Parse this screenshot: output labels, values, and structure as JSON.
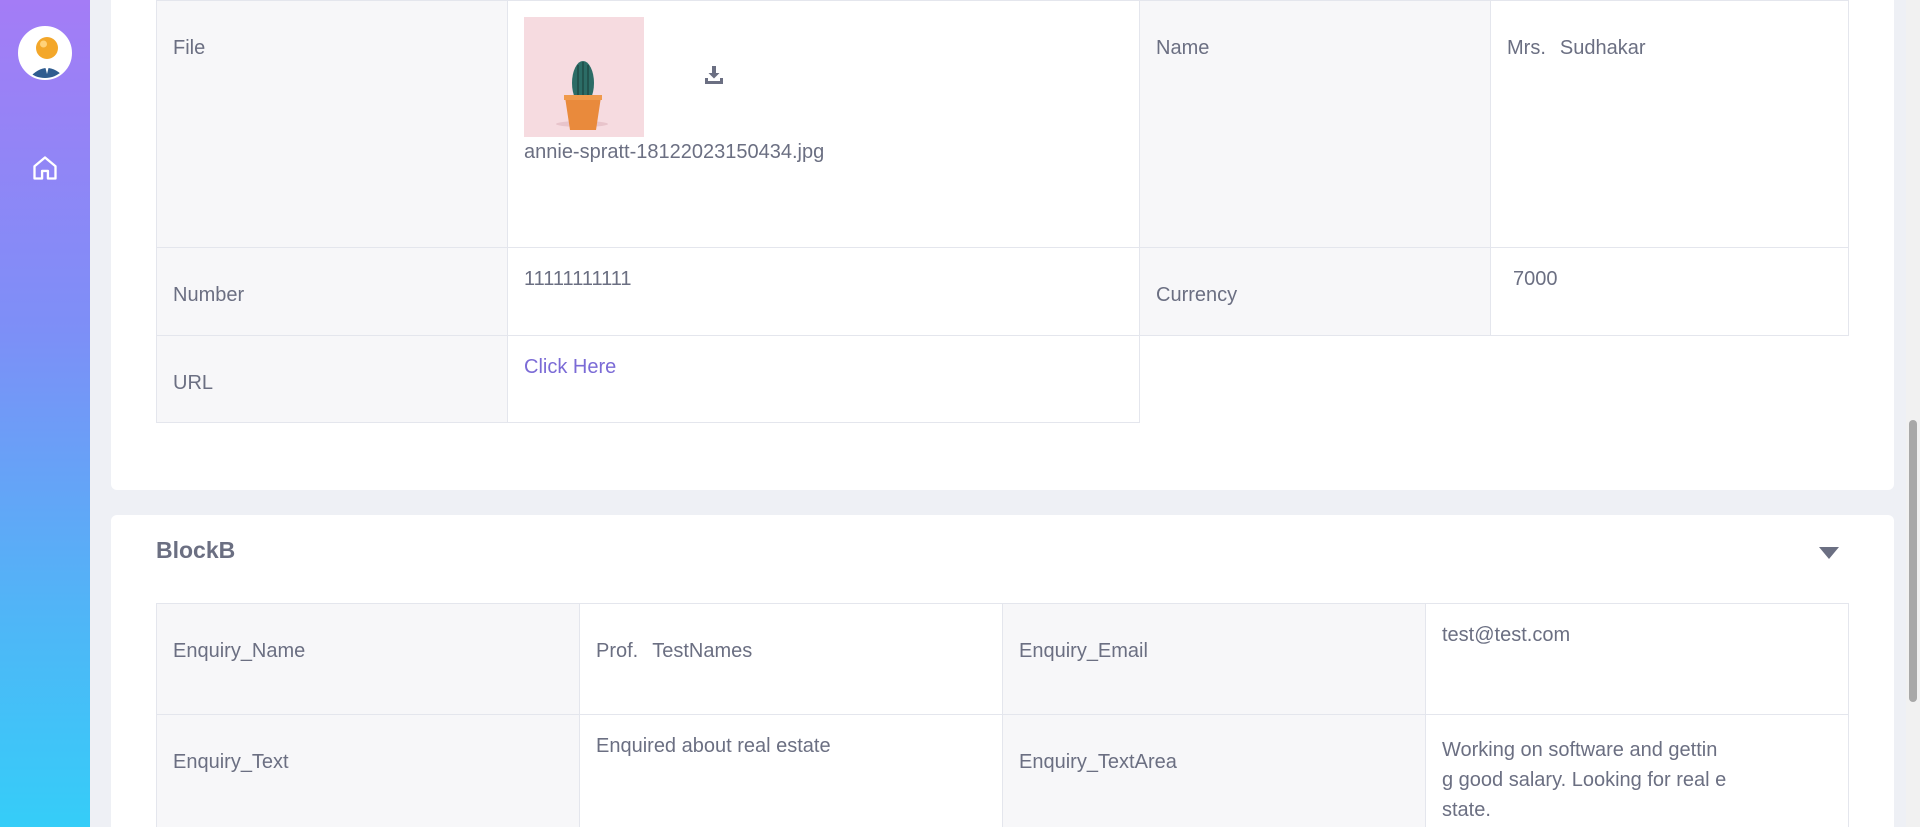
{
  "sidebar": {
    "avatar_icon": "user-avatar-icon",
    "nav": [
      {
        "icon": "home-icon"
      }
    ]
  },
  "block_a": {
    "rows": {
      "file": {
        "label": "File",
        "file_name": "annie-spratt-18122023150434.jpg",
        "download_icon": "download-icon"
      },
      "name": {
        "label": "Name",
        "prefix": "Mrs.",
        "value": "Sudhakar"
      },
      "number": {
        "label": "Number",
        "value": "11111111111"
      },
      "currency": {
        "label": "Currency",
        "value": "7000"
      },
      "url": {
        "label": "URL",
        "link_text": "Click Here"
      }
    }
  },
  "block_b": {
    "title": "BlockB",
    "collapse_icon": "caret-down-icon",
    "rows": {
      "enquiry_name": {
        "label": "Enquiry_Name",
        "prefix": "Prof.",
        "value": "TestNames"
      },
      "enquiry_email": {
        "label": "Enquiry_Email",
        "value": "test@test.com"
      },
      "enquiry_text": {
        "label": "Enquiry_Text",
        "value": "Enquired about real estate"
      },
      "enquiry_textarea": {
        "label": "Enquiry_TextArea",
        "value_lines": [
          "Working on software and gettin",
          "g good salary. Looking for real e",
          "state."
        ]
      }
    }
  },
  "colors": {
    "link": "#7b6bd6",
    "sidebar_top": "#a47cf6",
    "sidebar_bottom": "#35cdf8"
  }
}
